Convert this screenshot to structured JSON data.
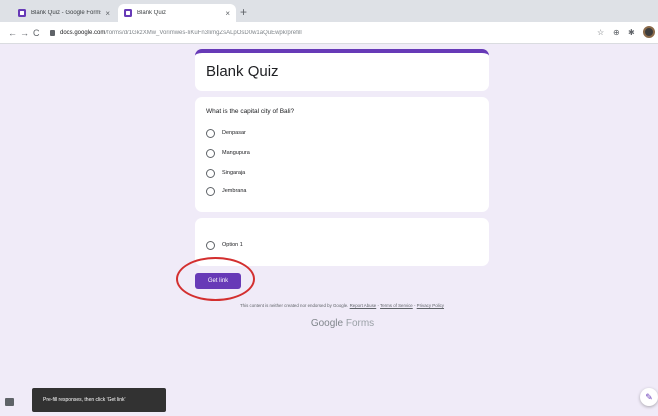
{
  "browser": {
    "tabs": [
      {
        "title": "Blank Quiz - Google Forms",
        "close": "×"
      },
      {
        "title": "Blank Quiz",
        "close": "×"
      }
    ],
    "new_tab": "+",
    "nav": {
      "back": "←",
      "forward": "→",
      "reload": "C"
    },
    "url_host": "docs.google.com",
    "url_path": "/forms/d/1GkzXMw_Vorimwes-IiKuFn3IimgZsALpOsD0w1aQuEwpk/prefill",
    "toolbar_icons": {
      "star": "☆",
      "extension_1": "⊕",
      "extension_2": "✱"
    }
  },
  "form": {
    "title": "Blank Quiz",
    "questions": [
      {
        "text": "What is the capital city of Bali?",
        "options": [
          "Denpasar",
          "Mangupura",
          "Singaraja",
          "Jembrana"
        ]
      },
      {
        "text": "",
        "options": [
          "Option 1"
        ]
      }
    ],
    "get_link_label": "Get link",
    "disclaimer": {
      "text": "This content is neither created nor endorsed by Google.",
      "report_abuse": "Report Abuse",
      "terms": "Terms of Service",
      "privacy": "Privacy Policy",
      "separator": " - "
    },
    "logo": {
      "google": "Google",
      "forms": "Forms"
    }
  },
  "snackbar": {
    "message": "Pre-fill responses, then click 'Get link'"
  },
  "colors": {
    "accent": "#673ab7",
    "background": "#f0ebf8",
    "annotation": "#d32f2f"
  },
  "icons": {
    "edit_fab": "✎"
  }
}
